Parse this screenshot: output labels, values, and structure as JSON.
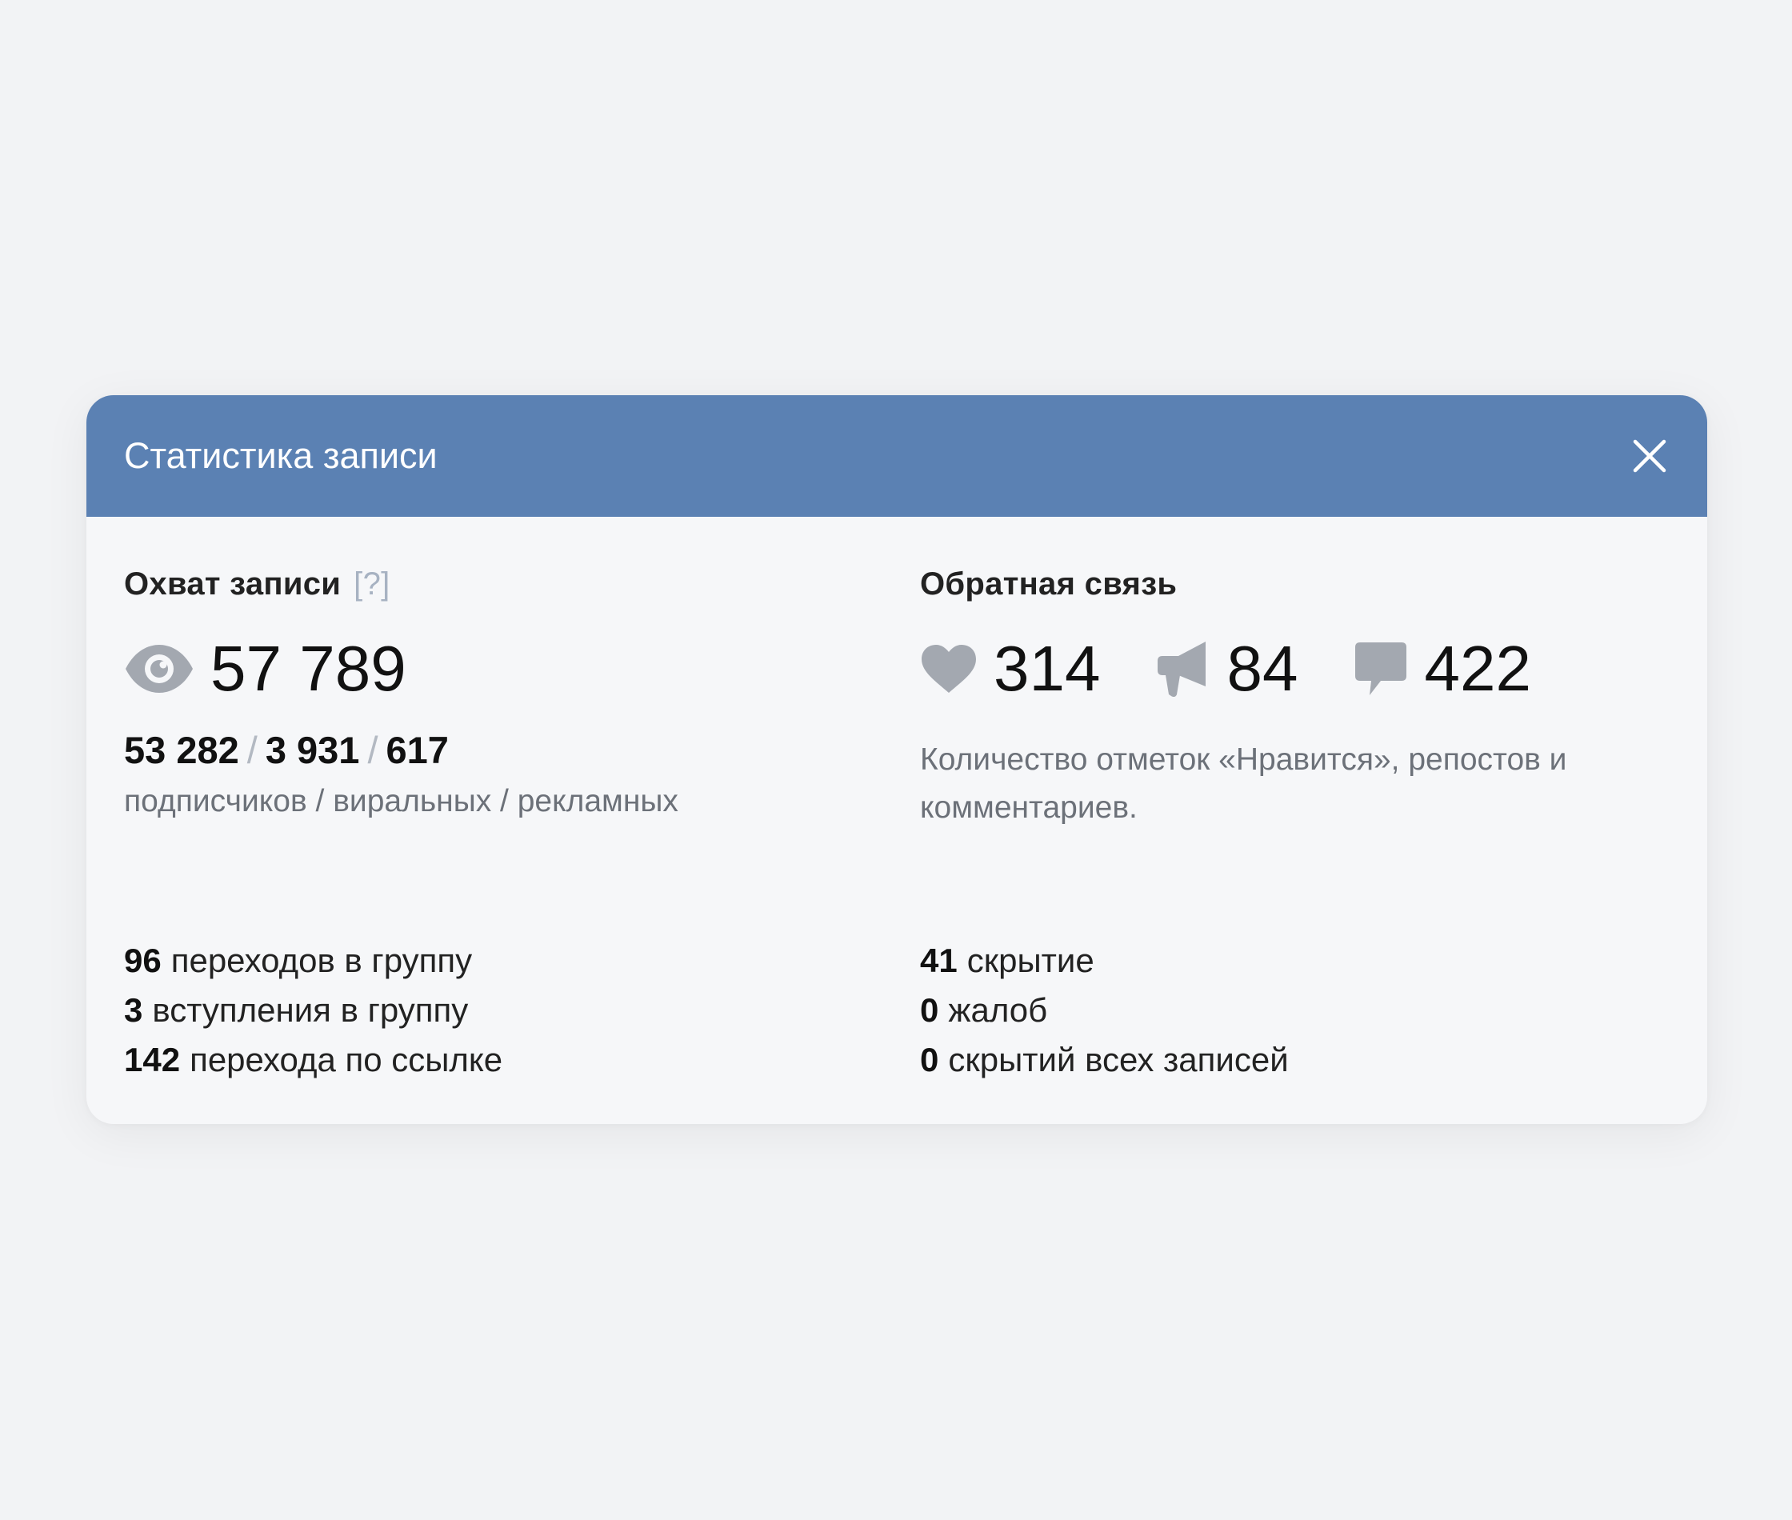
{
  "modal": {
    "title": "Статистика записи",
    "close_icon": "close-icon",
    "header_color": "#5b81b3"
  },
  "reach": {
    "title": "Охват записи",
    "help": "[?]",
    "icon": "eye-icon",
    "total": "57 789",
    "subscribers": "53 282",
    "viral": "3 931",
    "ads": "617",
    "separator": "/",
    "caption": "подписчиков / виральных / рекламных"
  },
  "feedback": {
    "title": "Обратная связь",
    "likes": {
      "icon": "heart-icon",
      "value": "314"
    },
    "reposts": {
      "icon": "megaphone-icon",
      "value": "84"
    },
    "comments": {
      "icon": "comment-icon",
      "value": "422"
    },
    "description": "Количество отметок «Нравится», репостов и комментариев."
  },
  "left_stats": [
    {
      "value": "96",
      "label": "переходов в группу"
    },
    {
      "value": "3",
      "label": "вступления в группу"
    },
    {
      "value": "142",
      "label": "перехода по ссылке"
    }
  ],
  "right_stats": [
    {
      "value": "41",
      "label": "скрытие"
    },
    {
      "value": "0",
      "label": "жалоб"
    },
    {
      "value": "0",
      "label": "скрытий всех записей"
    }
  ]
}
